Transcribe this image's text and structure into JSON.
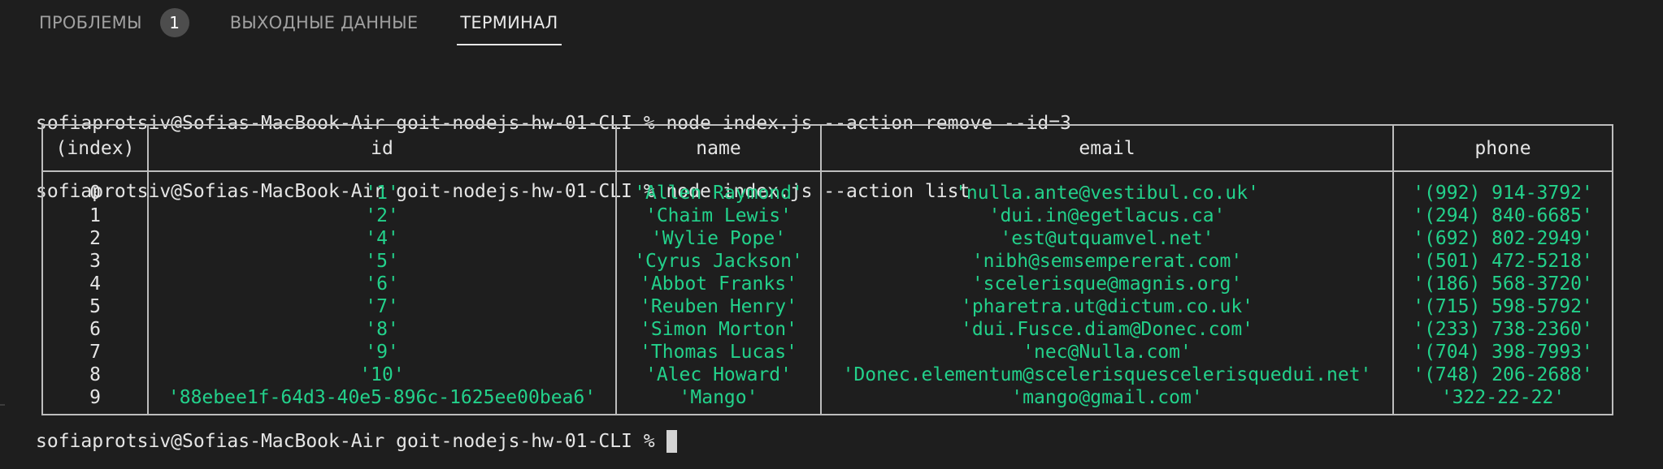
{
  "panel": {
    "tabs": [
      {
        "label": "ПРОБЛЕМЫ",
        "badge": "1",
        "active": false
      },
      {
        "label": "ВЫХОДНЫЕ ДАННЫЕ",
        "active": false
      },
      {
        "label": "ТЕРМИНАЛ",
        "active": true
      }
    ]
  },
  "terminal": {
    "lines": [
      "sofiaprotsiv@Sofias-MacBook-Air goit-nodejs-hw-01-CLI % node index.js --action remove --id=3",
      "sofiaprotsiv@Sofias-MacBook-Air goit-nodejs-hw-01-CLI % node index.js --action list"
    ],
    "table": {
      "headers": [
        "(index)",
        "id",
        "name",
        "email",
        "phone"
      ],
      "rows": [
        [
          "0",
          "'1'",
          "'Allen Raymond'",
          "'nulla.ante@vestibul.co.uk'",
          "'(992) 914-3792'"
        ],
        [
          "1",
          "'2'",
          "'Chaim Lewis'",
          "'dui.in@egetlacus.ca'",
          "'(294) 840-6685'"
        ],
        [
          "2",
          "'4'",
          "'Wylie Pope'",
          "'est@utquamvel.net'",
          "'(692) 802-2949'"
        ],
        [
          "3",
          "'5'",
          "'Cyrus Jackson'",
          "'nibh@semsempererat.com'",
          "'(501) 472-5218'"
        ],
        [
          "4",
          "'6'",
          "'Abbot Franks'",
          "'scelerisque@magnis.org'",
          "'(186) 568-3720'"
        ],
        [
          "5",
          "'7'",
          "'Reuben Henry'",
          "'pharetra.ut@dictum.co.uk'",
          "'(715) 598-5792'"
        ],
        [
          "6",
          "'8'",
          "'Simon Morton'",
          "'dui.Fusce.diam@Donec.com'",
          "'(233) 738-2360'"
        ],
        [
          "7",
          "'9'",
          "'Thomas Lucas'",
          "'nec@Nulla.com'",
          "'(704) 398-7993'"
        ],
        [
          "8",
          "'10'",
          "'Alec Howard'",
          "'Donec.elementum@scelerisquescelerisquedui.net'",
          "'(748) 206-2688'"
        ],
        [
          "9",
          "'88ebee1f-64d3-40e5-896c-1625ee00bea6'",
          "'Mango'",
          "'mango@gmail.com'",
          "'322-22-22'"
        ]
      ]
    },
    "prompt": "sofiaprotsiv@Sofias-MacBook-Air goit-nodejs-hw-01-CLI %"
  },
  "colors": {
    "background": "#1e1e1e",
    "string_value": "#23d18b",
    "text": "#e5e5e5"
  }
}
